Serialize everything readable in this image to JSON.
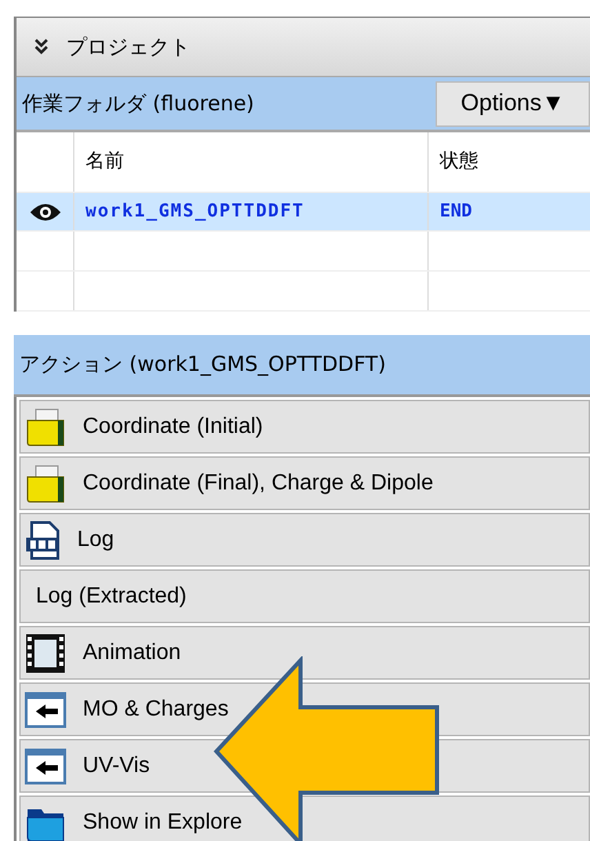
{
  "project_panel": {
    "title": "プロジェクト",
    "folder": "作業フォルダ (fluorene)",
    "options_button": "Options▼",
    "table": {
      "columns": [
        "名前",
        "状態"
      ],
      "rows": [
        {
          "name": "work1_GMS_OPTTDDFT",
          "status": "END",
          "selected": true,
          "visible": true
        }
      ]
    }
  },
  "actions_panel": {
    "title": "アクション (work1_GMS_OPTTDDFT)",
    "actions": [
      {
        "label": "Coordinate (Initial)",
        "kind": "folder"
      },
      {
        "label": "Coordinate (Final), Charge & Dipole",
        "kind": "folder"
      },
      {
        "label": "Log",
        "kind": "log"
      },
      {
        "label": "Log (Extracted)",
        "kind": "none"
      },
      {
        "label": "Animation",
        "kind": "film"
      },
      {
        "label": "MO & Charges",
        "kind": "import"
      },
      {
        "label": "UV-Vis",
        "kind": "import"
      },
      {
        "label": "Show in Explore",
        "kind": "explorer"
      }
    ]
  }
}
